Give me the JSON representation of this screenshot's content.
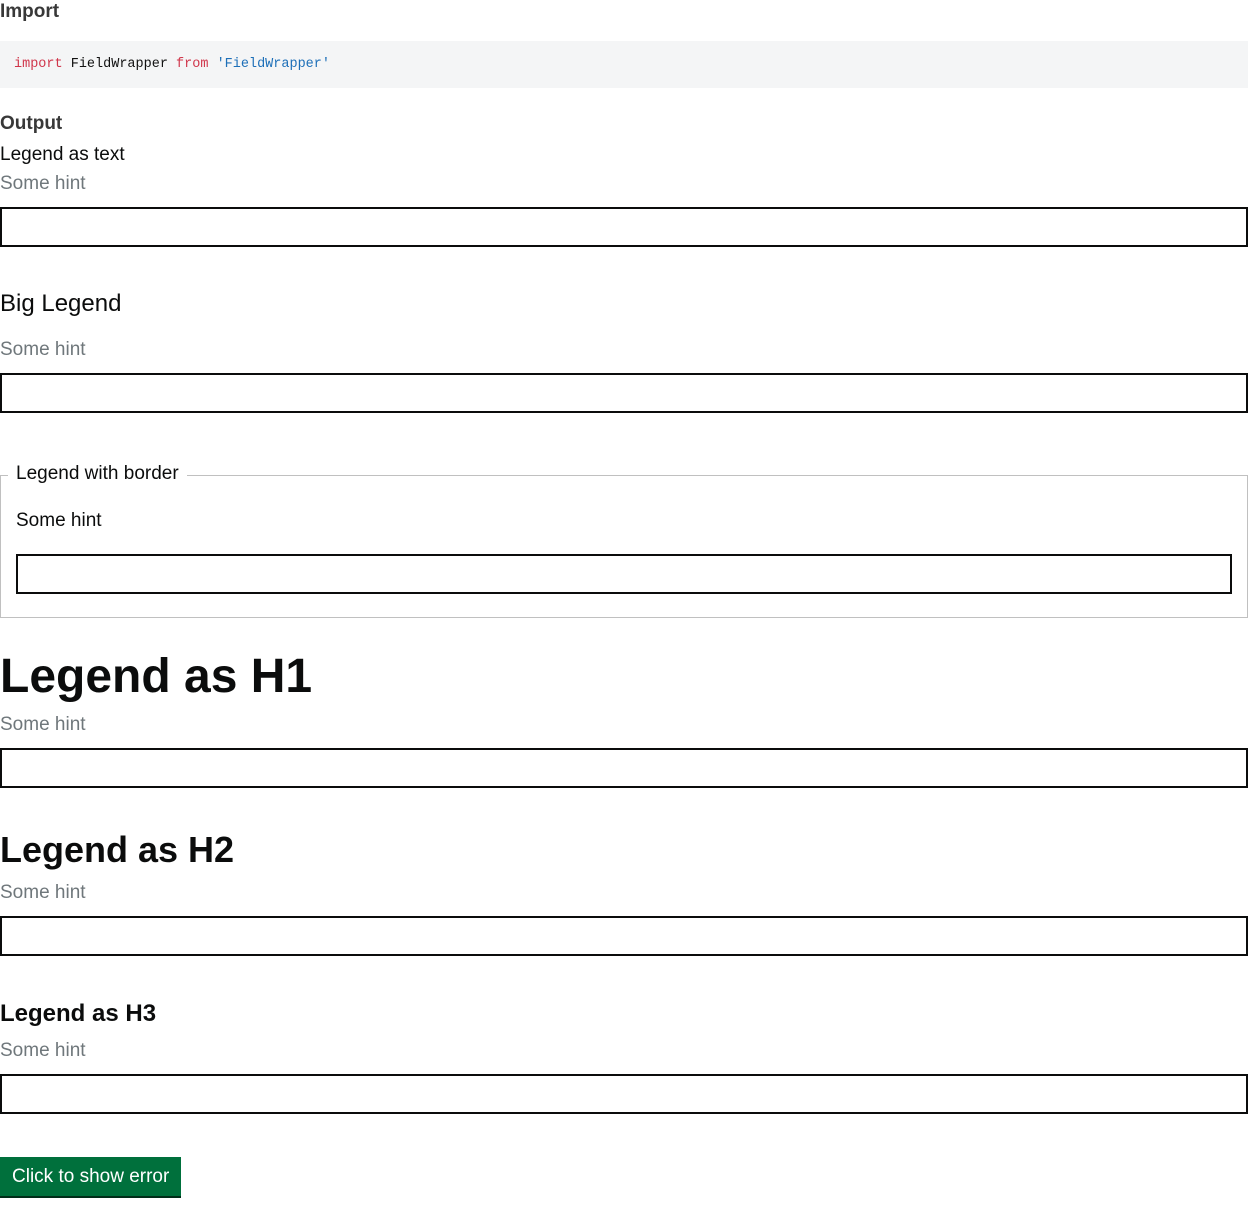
{
  "import_section": {
    "heading": "Import",
    "code": {
      "keyword_import": "import",
      "identifier": "FieldWrapper",
      "keyword_from": "from",
      "module_string": "'FieldWrapper'"
    }
  },
  "output_section": {
    "heading": "Output",
    "fields": [
      {
        "legend": "Legend as text",
        "hint": "Some hint",
        "value": ""
      },
      {
        "legend": "Big Legend",
        "hint": "Some hint",
        "value": ""
      },
      {
        "legend": "Legend with border",
        "hint": "Some hint",
        "value": ""
      },
      {
        "legend": "Legend as H1",
        "hint": "Some hint",
        "value": ""
      },
      {
        "legend": "Legend as H2",
        "hint": "Some hint",
        "value": ""
      },
      {
        "legend": "Legend as H3",
        "hint": "Some hint",
        "value": ""
      }
    ],
    "error_button_label": "Click to show error"
  },
  "colors": {
    "button_green": "#00703c",
    "hint_grey": "#6f777b",
    "code_keyword": "#d0364b",
    "code_string": "#1d6fb8",
    "code_background": "#f4f5f6"
  }
}
